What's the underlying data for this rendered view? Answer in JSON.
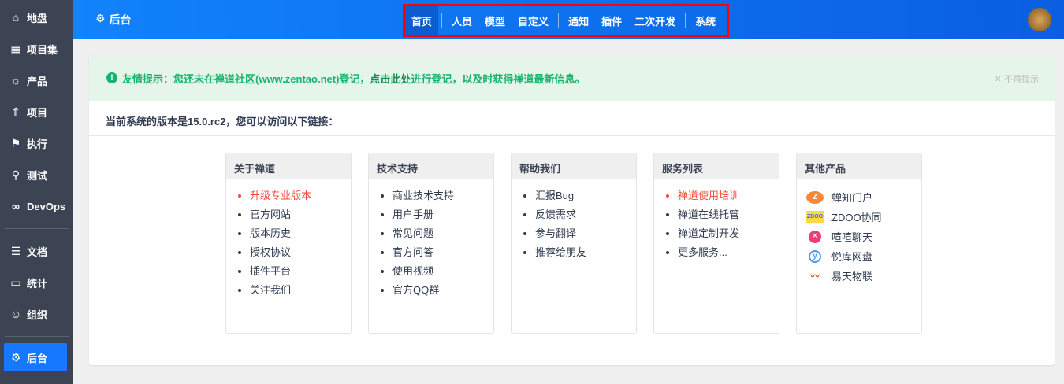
{
  "sidebar": {
    "items": [
      {
        "label": "地盘",
        "icon": "home-icon"
      },
      {
        "label": "项目集",
        "icon": "grid-icon"
      },
      {
        "label": "产品",
        "icon": "bulb-icon"
      },
      {
        "label": "项目",
        "icon": "rocket-icon"
      },
      {
        "label": "执行",
        "icon": "run-icon"
      },
      {
        "label": "测试",
        "icon": "search-icon"
      },
      {
        "label": "DevOps",
        "icon": "infinity-icon"
      }
    ],
    "items2": [
      {
        "label": "文档",
        "icon": "doc-icon"
      },
      {
        "label": "统计",
        "icon": "chart-icon"
      },
      {
        "label": "组织",
        "icon": "users-icon"
      }
    ],
    "active": {
      "label": "后台",
      "icon": "gear-icon"
    }
  },
  "header": {
    "title": "后台",
    "nav": [
      "首页",
      "人员",
      "模型",
      "自定义",
      "通知",
      "插件",
      "二次开发",
      "系统"
    ]
  },
  "tip": {
    "prefix": "友情提示：您还未在禅道社区(www.zentao.net)登记，",
    "link": "点击此处",
    "suffix": " 进行登记，以及时获得禅道最新信息。",
    "close": "不再提示"
  },
  "version_text": "当前系统的版本是15.0.rc2，您可以访问以下链接：",
  "cards": [
    {
      "title": "关于禅道",
      "items": [
        "升级专业版本",
        "官方网站",
        "版本历史",
        "授权协议",
        "插件平台",
        "关注我们"
      ]
    },
    {
      "title": "技术支持",
      "items": [
        "商业技术支持",
        "用户手册",
        "常见问题",
        "官方问答",
        "使用视频",
        "官方QQ群"
      ]
    },
    {
      "title": "帮助我们",
      "items": [
        "汇报Bug",
        "反馈需求",
        "参与翻译",
        "推荐给朋友"
      ]
    },
    {
      "title": "服务列表",
      "items": [
        "禅道使用培训",
        "禅道在线托管",
        "禅道定制开发",
        "更多服务..."
      ]
    }
  ],
  "products": {
    "title": "其他产品",
    "items": [
      "蝉知门户",
      "ZDOO协同",
      "喧喧聊天",
      "悦库网盘",
      "易天物联"
    ]
  }
}
